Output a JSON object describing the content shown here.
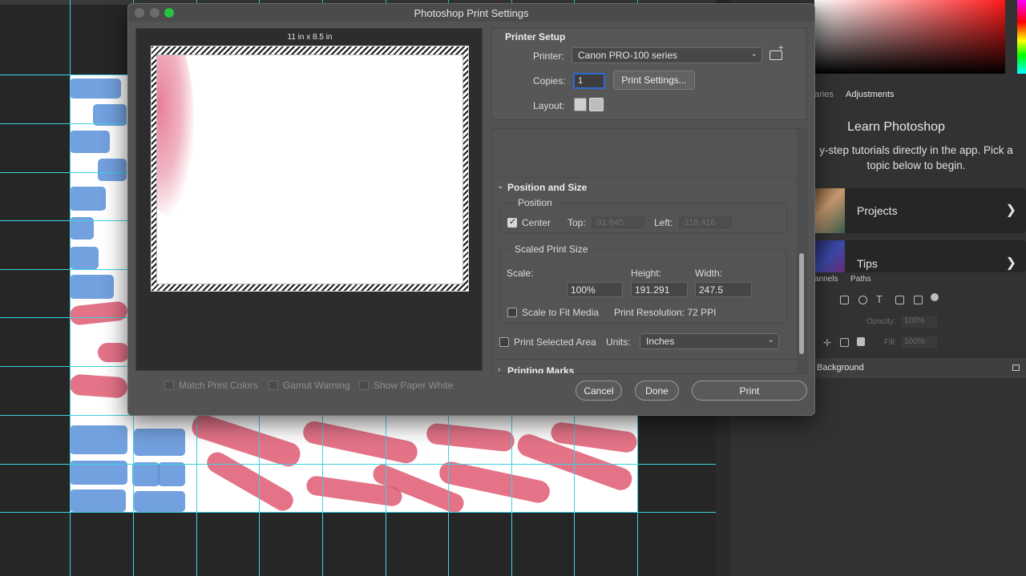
{
  "dialog": {
    "title": "Photoshop Print Settings",
    "paper_size": "11 in x 8.5 in",
    "preview_options": [
      {
        "label": "Match Print Colors",
        "checked": false
      },
      {
        "label": "Gamut Warning",
        "checked": false
      },
      {
        "label": "Show Paper White",
        "checked": false
      }
    ],
    "printer_setup": {
      "title": "Printer Setup",
      "printer_label": "Printer:",
      "printer_value": "Canon PRO-100 series",
      "copies_label": "Copies:",
      "copies_value": "1",
      "print_settings_button": "Print Settings...",
      "layout_label": "Layout:"
    },
    "position_and_size": {
      "title": "Position and Size",
      "position_group": "Position",
      "center_label": "Center",
      "center_checked": true,
      "top_label": "Top:",
      "top_value": "-91.645",
      "left_label": "Left:",
      "left_value": "-118.416",
      "scaled_group": "Scaled Print Size",
      "scale_label": "Scale:",
      "height_label": "Height:",
      "width_label": "Width:",
      "scale_value": "100%",
      "height_value": "191.291",
      "width_value": "247.5",
      "scale_to_fit_label": "Scale to Fit Media",
      "scale_to_fit_checked": false,
      "print_resolution": "Print Resolution: 72 PPI",
      "print_selected_label": "Print Selected Area",
      "print_selected_checked": false,
      "units_label": "Units:",
      "units_value": "Inches"
    },
    "printing_marks": {
      "title": "Printing Marks"
    },
    "buttons": {
      "cancel": "Cancel",
      "done": "Done",
      "print": "Print"
    }
  },
  "learn_panel": {
    "tab_partial": "aries",
    "tab_adjustments": "Adjustments",
    "title": "Learn Photoshop",
    "subtitle": "y-step tutorials directly in the app. Pick a topic below to begin.",
    "cards": [
      {
        "label": "Projects"
      },
      {
        "label": "Tips"
      }
    ]
  },
  "layers_panel": {
    "tab_channels": "annels",
    "tab_paths": "Paths",
    "opacity_label": "Opacity:",
    "opacity_value": "100%",
    "fill_label": "Fill:",
    "fill_value": "100%",
    "background_layer": "Background"
  },
  "icons": {
    "printer_add": "printer-add-icon",
    "portrait": "portrait-layout-icon",
    "landscape": "landscape-layout-icon",
    "lock": "lock-icon"
  },
  "colors": {
    "guide": "#3ed2e0",
    "brick_blue": "#5a8fd8",
    "stroke_pink": "#df5b72",
    "focus_blue": "#2f6bd6"
  }
}
